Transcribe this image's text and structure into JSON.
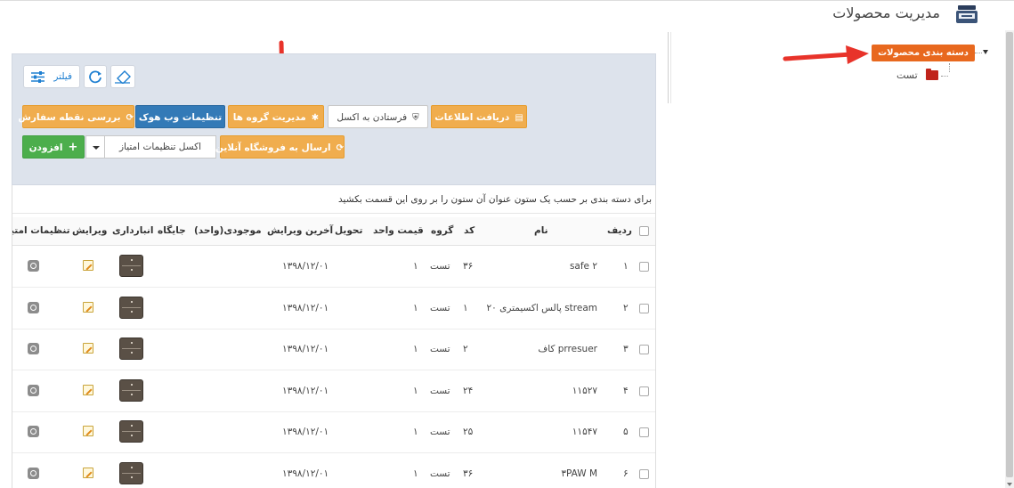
{
  "header": {
    "title": "مدیریت محصولات",
    "icon": "product-management-icon"
  },
  "tree": {
    "root_label": "دسته بندی محصولات",
    "children": [
      {
        "label": "تست",
        "icon": "folder-icon"
      }
    ]
  },
  "toolbar": {
    "filter_label": "فیلتر",
    "buttons": {
      "receive_info": "دریافت اطلاعات",
      "send_excel": "فرستادن به اکسل",
      "manage_groups": "مدیریت گروه ها",
      "webhook_settings": "تنظیمات وب هوک",
      "check_order_point": "بررسی نقطه سفارش",
      "send_online_store": "ارسال به فروشگاه آنلاین",
      "add": "افزودن"
    },
    "excel_select_value": "اکسل تنظیمات امتیاز"
  },
  "grid": {
    "hint": "برای دسته بندی بر حسب یک ستون عنوان آن ستون را بر روی این قسمت بکشید",
    "columns": {
      "row": "ردیف",
      "name": "نام",
      "code": "کد",
      "group": "گروه",
      "unit_price": "قیمت واحد",
      "delivery": "تحویل",
      "last_edit": "آخرین ویرایش",
      "stock": "موجودی(واحد)",
      "location": "جایگاه",
      "inventory": "انبارداری",
      "edit": "ویرایش",
      "rating_settings": "تنظیمات امتیا"
    },
    "rows": [
      {
        "row": "۱",
        "name": "safe ۲",
        "code": "۳۶",
        "group": "تست",
        "price": "۱",
        "last_edit": "۱۳۹۸/۱۲/۰۱"
      },
      {
        "row": "۲",
        "name": "پالس اکسیمتری ۲۰ stream",
        "code": "۱",
        "group": "تست",
        "price": "۱",
        "last_edit": "۱۳۹۸/۱۲/۰۱"
      },
      {
        "row": "۳",
        "name": "کاف prresuer",
        "code": "۲",
        "group": "تست",
        "price": "۱",
        "last_edit": "۱۳۹۸/۱۲/۰۱"
      },
      {
        "row": "۴",
        "name": "۱۱۵۲۷",
        "code": "۲۴",
        "group": "تست",
        "price": "۱",
        "last_edit": "۱۳۹۸/۱۲/۰۱"
      },
      {
        "row": "۵",
        "name": "۱۱۵۴۷",
        "code": "۲۵",
        "group": "تست",
        "price": "۱",
        "last_edit": "۱۳۹۸/۱۲/۰۱"
      },
      {
        "row": "۶",
        "name": "۳PAW M",
        "code": "۳۶",
        "group": "تست",
        "price": "۱",
        "last_edit": "۱۳۹۸/۱۲/۰۱"
      }
    ]
  },
  "colors": {
    "accent_orange": "#f0ad4e",
    "tree_root": "#e8681e",
    "blue": "#337ab7",
    "green": "#4cae4c",
    "arrow": "#e8332a"
  }
}
